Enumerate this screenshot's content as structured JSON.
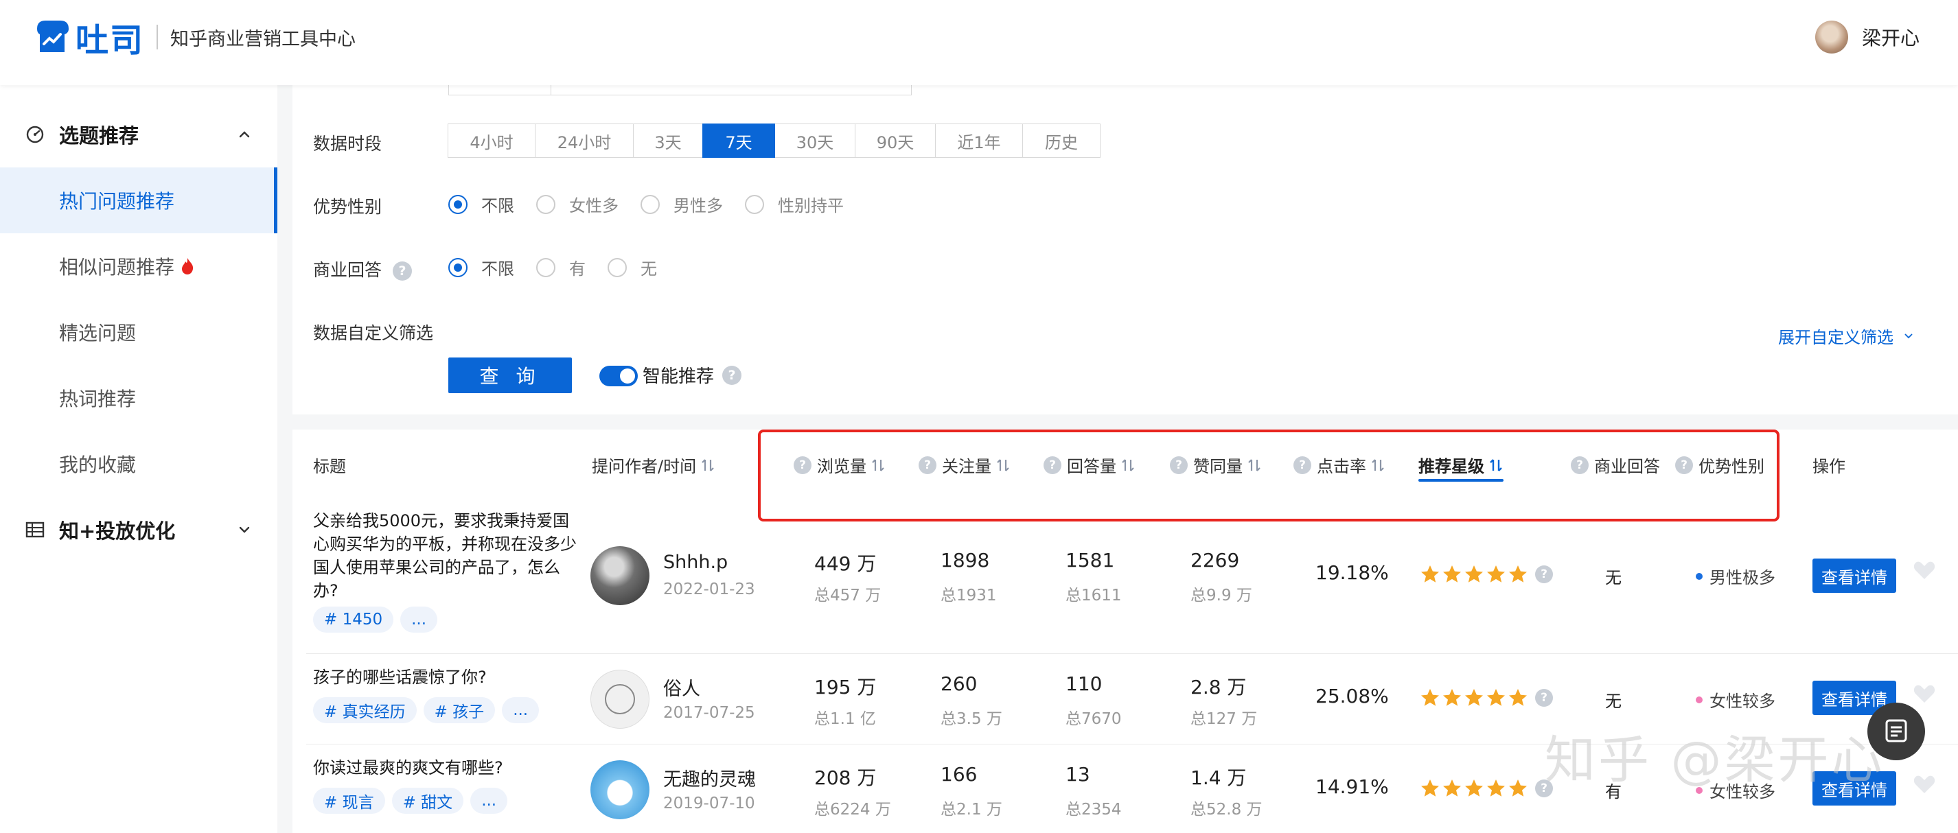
{
  "header": {
    "logo_text": "吐司",
    "subtitle": "知乎商业营销工具中心",
    "user_name": "梁开心"
  },
  "sidebar": {
    "groups": [
      {
        "label": "选题推荐",
        "expanded": true
      },
      {
        "label": "知+投放优化",
        "expanded": false
      }
    ],
    "items": [
      {
        "label": "热门问题推荐",
        "active": true
      },
      {
        "label": "相似问题推荐",
        "hot": true
      },
      {
        "label": "精选问题"
      },
      {
        "label": "热词推荐"
      },
      {
        "label": "我的收藏"
      }
    ]
  },
  "filters": {
    "time_label": "数据时段",
    "time_options": [
      "4小时",
      "24小时",
      "3天",
      "7天",
      "30天",
      "90天",
      "近1年",
      "历史"
    ],
    "time_selected": "7天",
    "gender_label": "优势性别",
    "gender_options": [
      "不限",
      "女性多",
      "男性多",
      "性别持平"
    ],
    "gender_selected": "不限",
    "biz_label": "商业回答",
    "biz_options": [
      "不限",
      "有",
      "无"
    ],
    "biz_selected": "不限",
    "custom_label": "数据自定义筛选",
    "query_button": "查 询",
    "smart_label": "智能推荐",
    "smart_on": true,
    "expand_link": "展开自定义筛选"
  },
  "table": {
    "headers": {
      "title": "标题",
      "author": "提问作者/时间",
      "views": "浏览量",
      "follows": "关注量",
      "answers": "回答量",
      "likes": "赞同量",
      "ctr": "点击率",
      "stars": "推荐星级",
      "biz": "商业回答",
      "gender": "优势性别",
      "action": "操作"
    },
    "detail_button": "查看详情",
    "rows": [
      {
        "title": "父亲给我5000元，要求我秉持爱国心购买华为的平板，并称现在没多少国人使用苹果公司的产品了，怎么办?",
        "tags": [
          "# 1450",
          "..."
        ],
        "author": "Shhh.p",
        "date": "2022-01-23",
        "views": "449 万",
        "views_total": "总457 万",
        "follows": "1898",
        "follows_total": "总1931",
        "answers": "1581",
        "answers_total": "总1611",
        "likes": "2269",
        "likes_total": "总9.9 万",
        "ctr": "19.18%",
        "stars": 5,
        "biz": "无",
        "gender": "男性极多",
        "gender_color": "#1a6fe0"
      },
      {
        "title": "孩子的哪些话震惊了你?",
        "tags": [
          "# 真实经历",
          "# 孩子",
          "..."
        ],
        "author": "俗人",
        "date": "2017-07-25",
        "views": "195 万",
        "views_total": "总1.1 亿",
        "follows": "260",
        "follows_total": "总3.5 万",
        "answers": "110",
        "answers_total": "总7670",
        "likes": "2.8 万",
        "likes_total": "总127 万",
        "ctr": "25.08%",
        "stars": 5,
        "biz": "无",
        "gender": "女性较多",
        "gender_color": "#f27bb5"
      },
      {
        "title": "你读过最爽的爽文有哪些?",
        "tags": [
          "# 现言",
          "# 甜文",
          "..."
        ],
        "author": "无趣的灵魂",
        "date": "2019-07-10",
        "views": "208 万",
        "views_total": "总6224 万",
        "follows": "166",
        "follows_total": "总2.1 万",
        "answers": "13",
        "answers_total": "总2354",
        "likes": "1.4 万",
        "likes_total": "总52.8 万",
        "ctr": "14.91%",
        "stars": 5,
        "biz": "有",
        "gender": "女性较多",
        "gender_color": "#f27bb5"
      }
    ]
  },
  "watermark": "知乎 @梁开心",
  "colors": {
    "accent": "#0a66d6",
    "highlight_box": "#e8251f",
    "star": "#f5a623"
  }
}
